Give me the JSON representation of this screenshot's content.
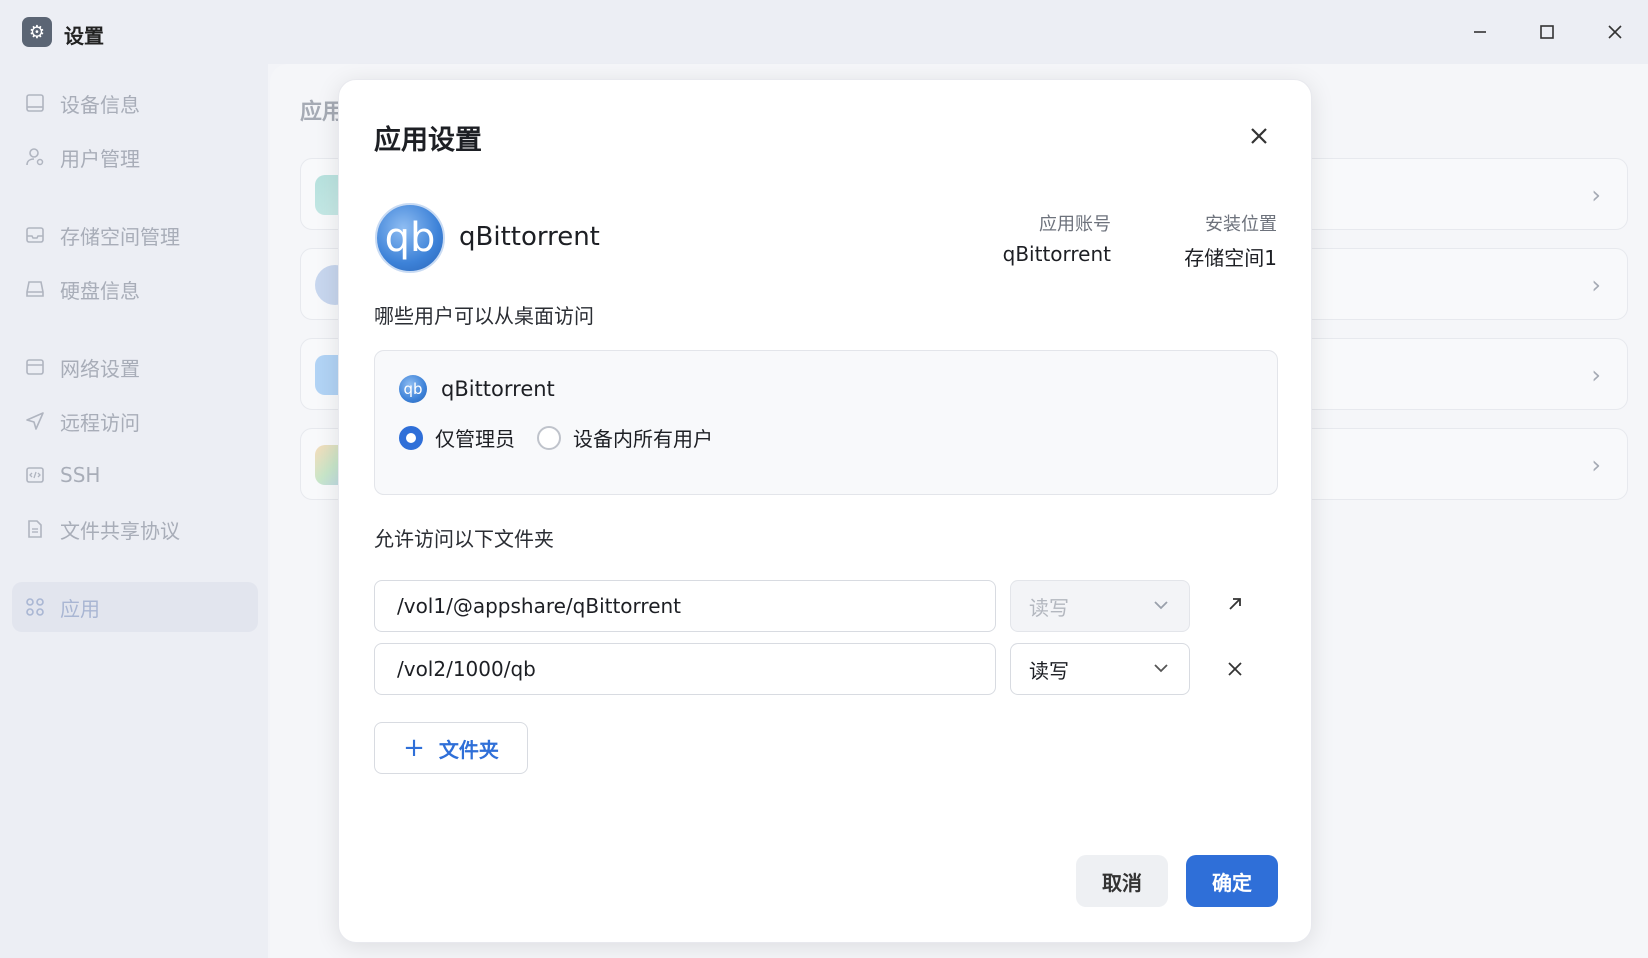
{
  "window": {
    "title": "设置",
    "icon": "gear-icon",
    "controls": [
      "minimize-icon",
      "maximize-icon",
      "close-icon"
    ]
  },
  "sidebar": {
    "items": [
      {
        "label": "设备信息",
        "icon": "device-info-icon",
        "active": false
      },
      {
        "label": "用户管理",
        "icon": "user-icon",
        "active": false
      },
      {
        "label": "存储空间管理",
        "icon": "storage-icon",
        "active": false
      },
      {
        "label": "硬盘信息",
        "icon": "disk-icon",
        "active": false
      },
      {
        "label": "网络设置",
        "icon": "network-icon",
        "active": false
      },
      {
        "label": "远程访问",
        "icon": "send-icon",
        "active": false
      },
      {
        "label": "SSH",
        "icon": "code-icon",
        "active": false
      },
      {
        "label": "文件共享协议",
        "icon": "document-icon",
        "active": false
      },
      {
        "label": "应用",
        "icon": "apps-grid-icon",
        "active": true
      }
    ]
  },
  "main": {
    "title": "应用"
  },
  "dialog": {
    "title": "应用设置",
    "app_name": "qBittorrent",
    "app_logo_text": "qb",
    "account_label": "应用账号",
    "account_value": "qBittorrent",
    "location_label": "安装位置",
    "location_value": "存储空间1",
    "desktop_access_label": "哪些用户可以从桌面访问",
    "access_app_name": "qBittorrent",
    "access_options": [
      {
        "label": "仅管理员",
        "selected": true
      },
      {
        "label": "设备内所有用户",
        "selected": false
      }
    ],
    "folders_label": "允许访问以下文件夹",
    "folders": [
      {
        "path": "/vol1/@appshare/qBittorrent",
        "permission": "读写",
        "disabled": true,
        "action_icon": "open-external-icon"
      },
      {
        "path": "/vol2/1000/qb",
        "permission": "读写",
        "disabled": false,
        "action_icon": "remove-icon"
      }
    ],
    "add_folder_label": "文件夹",
    "cancel_label": "取消",
    "confirm_label": "确定"
  },
  "colors": {
    "accent": "#2f6fd8",
    "sidebar_bg": "#eceef4",
    "dialog_bg": "#ffffff"
  }
}
